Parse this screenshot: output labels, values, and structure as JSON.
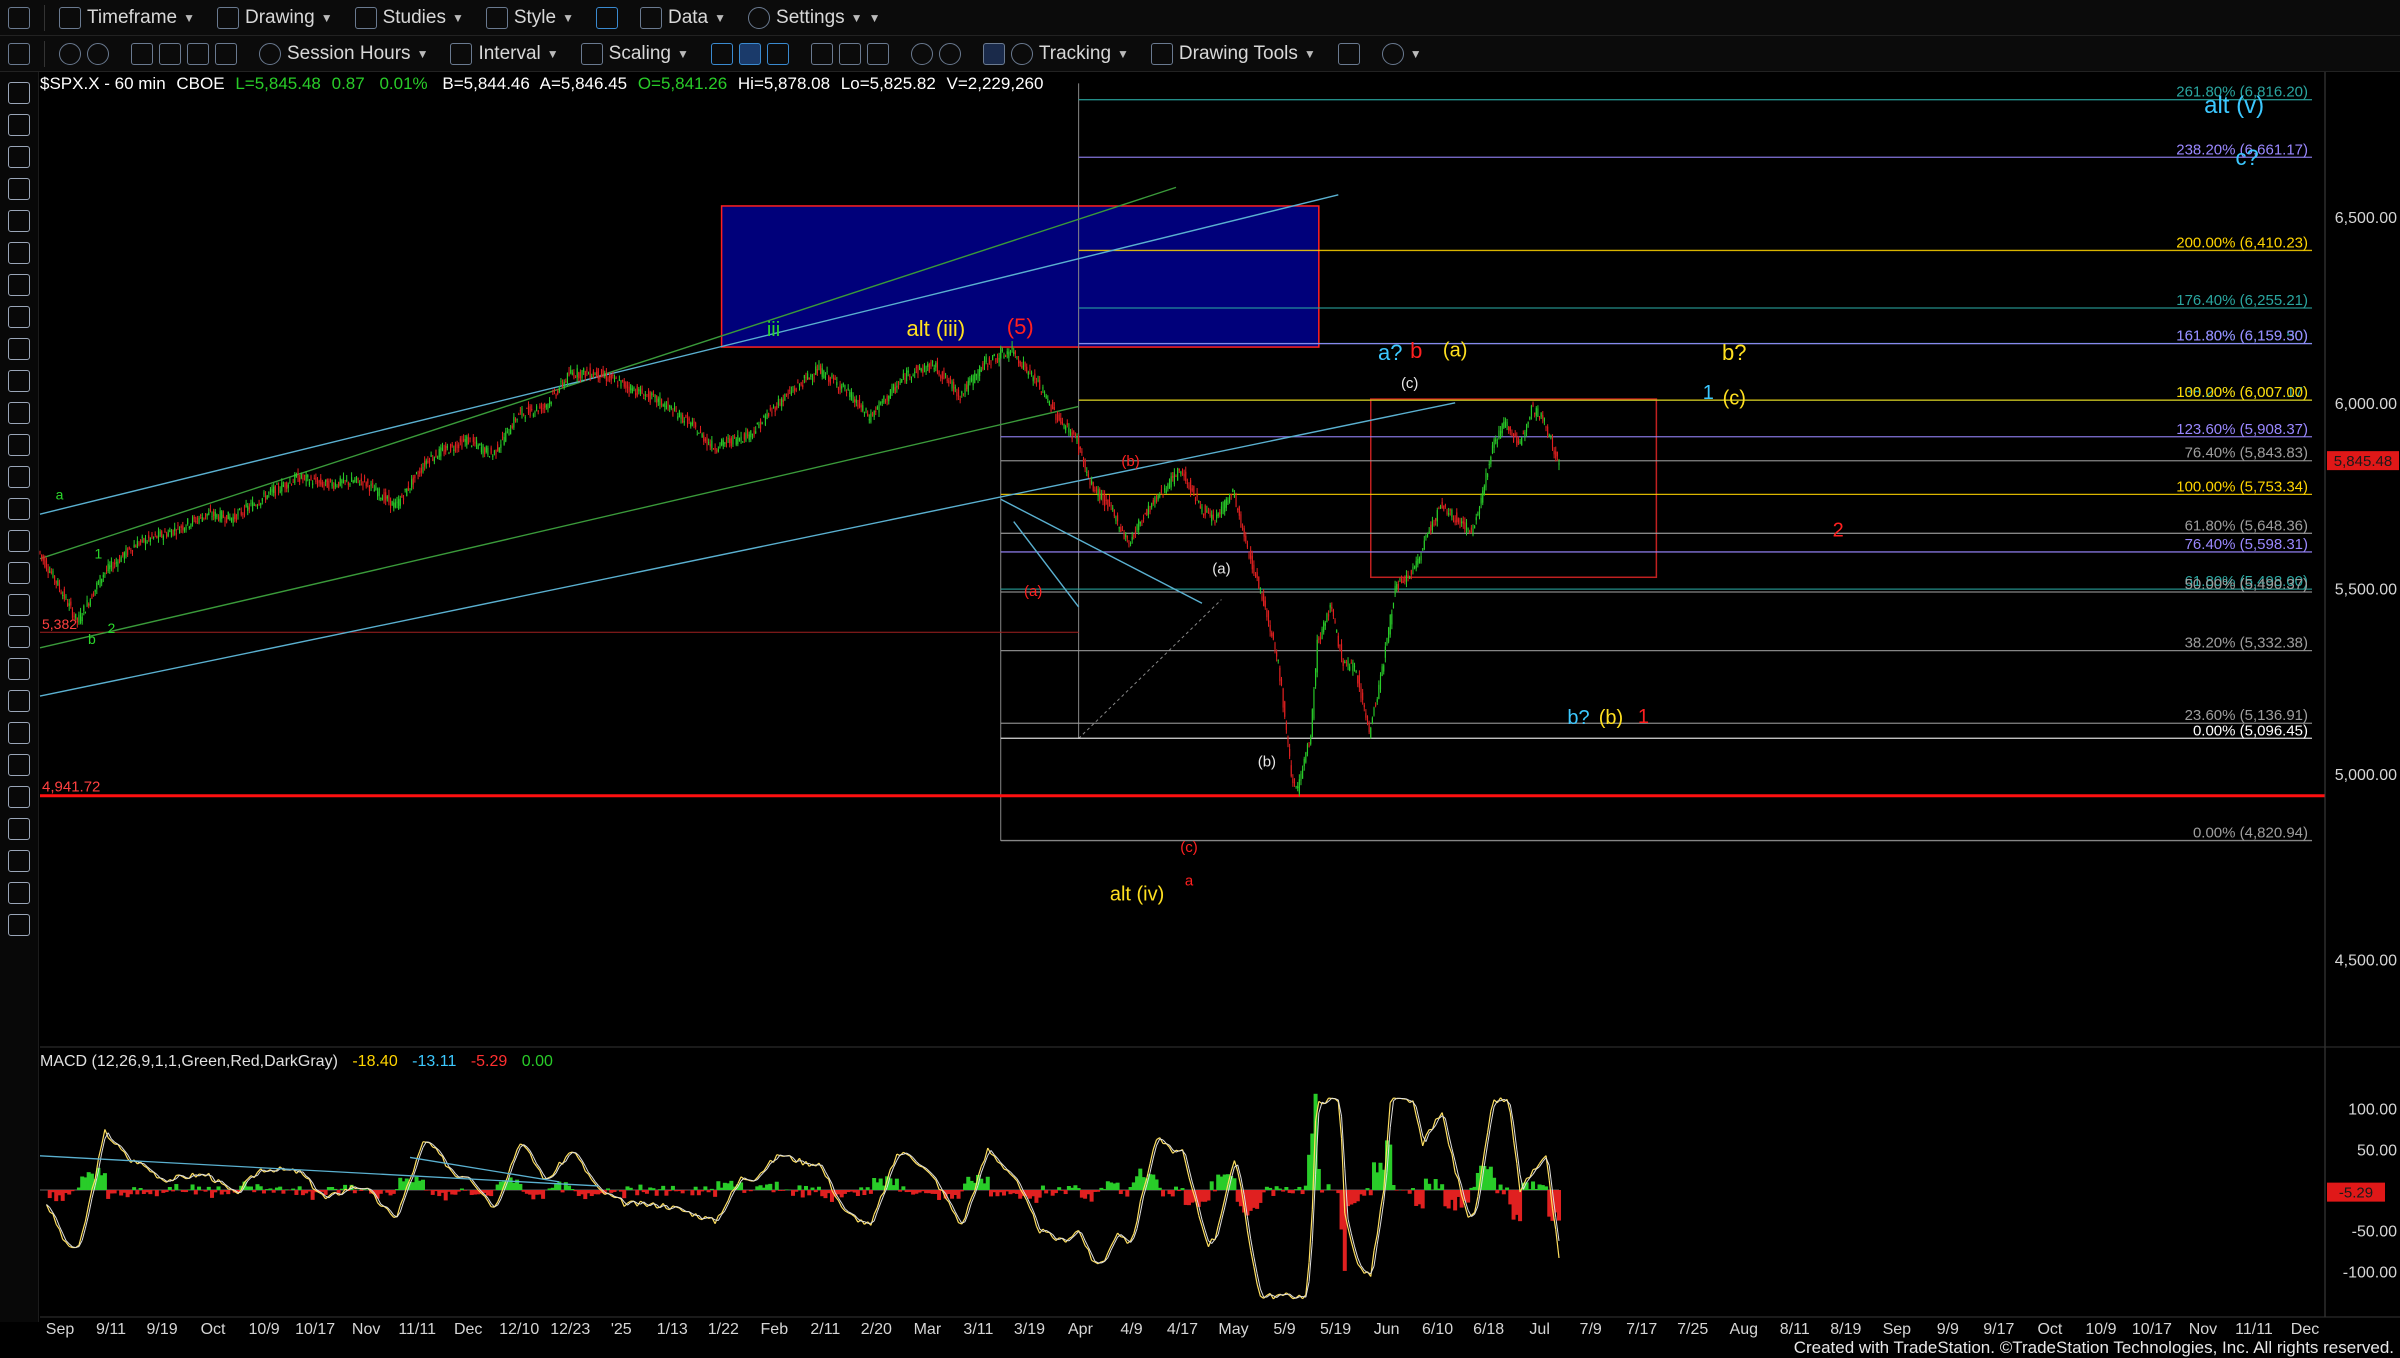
{
  "toolbar": {
    "row1": [
      {
        "label": "Timeframe",
        "icon": "clock-icon"
      },
      {
        "label": "Drawing",
        "icon": "pencil-icon"
      },
      {
        "label": "Studies",
        "icon": "flask-icon"
      },
      {
        "label": "Style",
        "icon": "style-icon"
      },
      {
        "label": "Data",
        "icon": "bars-icon"
      },
      {
        "label": "Settings",
        "icon": "gear-icon"
      }
    ],
    "row2": [
      {
        "label": "Session Hours",
        "icon": "session-icon"
      },
      {
        "label": "Interval",
        "icon": "interval-icon"
      },
      {
        "label": "Scaling",
        "icon": "scaling-icon"
      },
      {
        "label": "Tracking",
        "icon": "tracking-icon"
      },
      {
        "label": "Drawing Tools",
        "icon": "drawing-tools-icon"
      }
    ]
  },
  "header": {
    "symbol": "$SPX.X - 60 min",
    "exchange": "CBOE",
    "last": "L=5,845.48",
    "chg": "0.87",
    "pct": "0.01%",
    "bid": "B=5,844.46",
    "ask": "A=5,846.45",
    "open": "O=5,841.26",
    "hi": "Hi=5,878.08",
    "lo": "Lo=5,825.82",
    "vol": "V=2,229,260"
  },
  "footer": "Created with TradeStation. ©TradeStation Technologies, Inc. All rights reserved.",
  "colors": {
    "up": "#29cc29",
    "down": "#e02020",
    "blue_zone": "#00007a",
    "red_line": "#ff1010"
  },
  "chart_data": {
    "type": "line",
    "series_type": "candlestick price 60 min",
    "ylim": [
      4300,
      6880
    ],
    "y_ticks": [
      {
        "v": 6500,
        "label": "6,500.00"
      },
      {
        "v": 6000,
        "label": "6,000.00"
      },
      {
        "v": 5500,
        "label": "5,500.00"
      },
      {
        "v": 5000,
        "label": "5,000.00"
      },
      {
        "v": 4500,
        "label": "4,500.00"
      }
    ],
    "x_ticks": [
      "Sep",
      "9/11",
      "9/19",
      "Oct",
      "10/9",
      "10/17",
      "Nov",
      "11/11",
      "Dec",
      "12/10",
      "12/23",
      "'25",
      "1/13",
      "1/22",
      "Feb",
      "2/11",
      "2/20",
      "Mar",
      "3/11",
      "3/19",
      "Apr",
      "4/9",
      "4/17",
      "May",
      "5/9",
      "5/19",
      "Jun",
      "6/10",
      "6/18",
      "Jul",
      "7/9",
      "7/17",
      "7/25",
      "Aug",
      "8/11",
      "8/19",
      "Sep",
      "9/9",
      "9/17",
      "Oct",
      "10/9",
      "10/17",
      "Nov",
      "11/11",
      "Dec"
    ],
    "last_price": {
      "value": 5845.48,
      "label": "5,845.48"
    },
    "price_path": [
      [
        0,
        5600
      ],
      [
        3,
        5510
      ],
      [
        6,
        5410
      ],
      [
        10,
        5540
      ],
      [
        15,
        5620
      ],
      [
        20,
        5650
      ],
      [
        26,
        5700
      ],
      [
        30,
        5690
      ],
      [
        36,
        5760
      ],
      [
        40,
        5800
      ],
      [
        44,
        5780
      ],
      [
        50,
        5790
      ],
      [
        55,
        5720
      ],
      [
        60,
        5850
      ],
      [
        66,
        5900
      ],
      [
        70,
        5860
      ],
      [
        74,
        5970
      ],
      [
        78,
        5990
      ],
      [
        82,
        6080
      ],
      [
        86,
        6080
      ],
      [
        90,
        6050
      ],
      [
        96,
        6000
      ],
      [
        100,
        5950
      ],
      [
        104,
        5880
      ],
      [
        110,
        5920
      ],
      [
        114,
        6000
      ],
      [
        120,
        6090
      ],
      [
        124,
        6040
      ],
      [
        128,
        5960
      ],
      [
        134,
        6080
      ],
      [
        138,
        6100
      ],
      [
        142,
        6020
      ],
      [
        146,
        6110
      ],
      [
        150,
        6140
      ],
      [
        154,
        6050
      ],
      [
        157,
        5960
      ],
      [
        160,
        5900
      ],
      [
        162,
        5780
      ],
      [
        165,
        5720
      ],
      [
        168,
        5620
      ],
      [
        170,
        5690
      ],
      [
        173,
        5760
      ],
      [
        176,
        5820
      ],
      [
        179,
        5720
      ],
      [
        181,
        5680
      ],
      [
        184,
        5760
      ],
      [
        186,
        5620
      ],
      [
        189,
        5450
      ],
      [
        191,
        5300
      ],
      [
        192,
        5150
      ],
      [
        193,
        5000
      ],
      [
        194,
        4960
      ],
      [
        196,
        5100
      ],
      [
        197,
        5350
      ],
      [
        199,
        5450
      ],
      [
        201,
        5300
      ],
      [
        203,
        5280
      ],
      [
        205,
        5110
      ],
      [
        207,
        5280
      ],
      [
        209,
        5500
      ],
      [
        212,
        5550
      ],
      [
        214,
        5650
      ],
      [
        216,
        5720
      ],
      [
        219,
        5680
      ],
      [
        221,
        5650
      ],
      [
        224,
        5880
      ],
      [
        226,
        5950
      ],
      [
        228,
        5880
      ],
      [
        230,
        5990
      ],
      [
        232,
        5950
      ],
      [
        234,
        5845
      ]
    ],
    "horizontal_levels": [
      {
        "v": 6816.2,
        "pct": "261.80%",
        "label": "261.80% (6,816.20)",
        "color": "#2aa6a0"
      },
      {
        "v": 6661.17,
        "pct": "238.20%",
        "label": "238.20% (6,661.17)",
        "color": "#9a88ff"
      },
      {
        "v": 6410.23,
        "pct": "200.00%",
        "label": "200.00% (6,410.23)",
        "color": "#ffd400"
      },
      {
        "v": 6255.21,
        "pct": "176.40%",
        "label": "176.40% (6,255.21)",
        "color": "#2aa6a0"
      },
      {
        "v": 6159.5,
        "pct": "161.80%",
        "label": "161.80% (6,159.50)",
        "color": "#2aa6a0"
      },
      {
        "v": 6159.3,
        "pct": "161.80%",
        "label": "161.80% (6,159.30)",
        "color": "#9a88ff"
      },
      {
        "v": 6007.17,
        "pct": "138.20%",
        "label": "138.20% (6,007.17)",
        "color": "#2aa6a0"
      },
      {
        "v": 6007.0,
        "pct": "100.00%",
        "label": "100.00% (6,007.00)",
        "color": "#ffd400"
      },
      {
        "v": 5908.37,
        "pct": "123.60%",
        "label": "123.60% (5,908.37)",
        "color": "#9a88ff"
      },
      {
        "v": 5843.83,
        "pct": "76.40%",
        "label": "76.40% (5,843.83)",
        "color": "#9e9e9e"
      },
      {
        "v": 5753.34,
        "pct": "100.00%",
        "label": "100.00% (5,753.34)",
        "color": "#ffd400"
      },
      {
        "v": 5648.36,
        "pct": "61.80%",
        "label": "61.80% (5,648.36)",
        "color": "#9e9e9e"
      },
      {
        "v": 5598.31,
        "pct": "76.40%",
        "label": "76.40% (5,598.31)",
        "color": "#9a88ff"
      },
      {
        "v": 5498.0,
        "pct": "61.80%",
        "label": "61.80% (5,498.00)",
        "color": "#2aa6a0"
      },
      {
        "v": 5490.37,
        "pct": "50.00%",
        "label": "50.00% (5,490.37)",
        "color": "#9e9e9e"
      },
      {
        "v": 5332.38,
        "pct": "38.20%",
        "label": "38.20% (5,332.38)",
        "color": "#9e9e9e"
      },
      {
        "v": 5136.91,
        "pct": "23.60%",
        "label": "23.60% (5,136.91)",
        "color": "#9e9e9e"
      },
      {
        "v": 5096.45,
        "pct": "0.00%",
        "label": "0.00% (5,096.45)",
        "color": "#ffffff"
      },
      {
        "v": 4820.94,
        "pct": "0.00%",
        "label": "0.00% (4,820.94)",
        "color": "#9e9e9e"
      }
    ],
    "support_line": {
      "v": 4941.72,
      "label": "4,941.72"
    },
    "left_label": {
      "v": 5382.0,
      "label": "5,382"
    },
    "zones": [
      {
        "name": "blue-target-zone",
        "x0": 105,
        "x1": 197,
        "y0": 6150,
        "y1": 6530,
        "color": "#00007a",
        "border": "#ff2020"
      },
      {
        "name": "red-box",
        "x0": 205,
        "x1": 249,
        "y0": 5530,
        "y1": 6010,
        "border": "#c02020"
      }
    ],
    "wave_labels": [
      {
        "text": "iii",
        "x": 113,
        "y": 6180,
        "color": "#2ad62a",
        "size": 20
      },
      {
        "text": "alt (iii)",
        "x": 138,
        "y": 6180,
        "color": "#ffe020",
        "size": 22
      },
      {
        "text": "(5)",
        "x": 151,
        "y": 6185,
        "color": "#ff2020",
        "size": 22
      },
      {
        "text": "a?",
        "x": 208,
        "y": 6115,
        "color": "#3cc8ff",
        "size": 22
      },
      {
        "text": "b",
        "x": 212,
        "y": 6120,
        "color": "#ff2020",
        "size": 22
      },
      {
        "text": "(a)",
        "x": 218,
        "y": 6125,
        "color": "#ffe020",
        "size": 20
      },
      {
        "text": "(c)",
        "x": 211,
        "y": 6040,
        "color": "#e6e6e6",
        "size": 15
      },
      {
        "text": "b?",
        "x": 261,
        "y": 6115,
        "color": "#ffe020",
        "size": 22
      },
      {
        "text": "1",
        "x": 257,
        "y": 6010,
        "color": "#3cc8ff",
        "size": 20
      },
      {
        "text": "(c)",
        "x": 261,
        "y": 5995,
        "color": "#ffe020",
        "size": 20
      },
      {
        "text": "alt (v)",
        "x": 338,
        "y": 6780,
        "color": "#3cc8ff",
        "size": 24
      },
      {
        "text": "c?",
        "x": 340,
        "y": 6640,
        "color": "#3cc8ff",
        "size": 22
      },
      {
        "text": "2",
        "x": 277,
        "y": 5640,
        "color": "#ff2020",
        "size": 20
      },
      {
        "text": "b?",
        "x": 237,
        "y": 5135,
        "color": "#3cc8ff",
        "size": 20
      },
      {
        "text": "(b)",
        "x": 242,
        "y": 5135,
        "color": "#ffe020",
        "size": 20
      },
      {
        "text": "1",
        "x": 247,
        "y": 5138,
        "color": "#ff2020",
        "size": 20
      },
      {
        "text": "(b)",
        "x": 168,
        "y": 5830,
        "color": "#ff2020",
        "size": 15
      },
      {
        "text": "(a)",
        "x": 153,
        "y": 5480,
        "color": "#ff2020",
        "size": 15
      },
      {
        "text": "(a)",
        "x": 182,
        "y": 5540,
        "color": "#e6e6e6",
        "size": 15
      },
      {
        "text": "(b)",
        "x": 189,
        "y": 5020,
        "color": "#e6e6e6",
        "size": 15
      },
      {
        "text": "(c)",
        "x": 177,
        "y": 4790,
        "color": "#ff2020",
        "size": 15
      },
      {
        "text": "a",
        "x": 177,
        "y": 4700,
        "color": "#ff2020",
        "size": 15
      },
      {
        "text": "alt (iv)",
        "x": 169,
        "y": 4660,
        "color": "#ffe020",
        "size": 20
      },
      {
        "text": "a",
        "x": 3,
        "y": 5740,
        "color": "#2ad62a",
        "size": 14
      },
      {
        "text": "1",
        "x": 9,
        "y": 5580,
        "color": "#2ad62a",
        "size": 14
      },
      {
        "text": "2",
        "x": 11,
        "y": 5380,
        "color": "#2ad62a",
        "size": 14
      },
      {
        "text": "b",
        "x": 8,
        "y": 5350,
        "color": "#2ad62a",
        "size": 14
      }
    ],
    "trendlines": [
      {
        "x0": 0,
        "y0": 5580,
        "x1": 175,
        "y1": 6580,
        "color": "#3a9a3a"
      },
      {
        "x0": 0,
        "y0": 5700,
        "x1": 200,
        "y1": 6560,
        "color": "#5ab0d0"
      },
      {
        "x0": 0,
        "y0": 5210,
        "x1": 218,
        "y1": 6000,
        "color": "#5ab0d0"
      },
      {
        "x0": 0,
        "y0": 5340,
        "x1": 160,
        "y1": 5990,
        "color": "#3a9a3a"
      },
      {
        "x0": 150,
        "y0": 5680,
        "x1": 160,
        "y1": 5450,
        "color": "#5ab0d0"
      },
      {
        "x0": 148,
        "y0": 5740,
        "x1": 179,
        "y1": 5460,
        "color": "#5ab0d0"
      }
    ]
  },
  "macd": {
    "title": "MACD (12,26,9,1,1,Green,Red,DarkGray)",
    "v1": "-18.40",
    "v2": "-13.11",
    "v3": "-5.29",
    "v4": "0.00",
    "last": "-5.29",
    "ylim": [
      -140,
      140
    ],
    "y_ticks": [
      {
        "v": 100,
        "label": "100.00"
      },
      {
        "v": 50,
        "label": "50.00"
      },
      {
        "v": -50,
        "label": "-50.00"
      },
      {
        "v": -100,
        "label": "-100.00"
      }
    ]
  }
}
